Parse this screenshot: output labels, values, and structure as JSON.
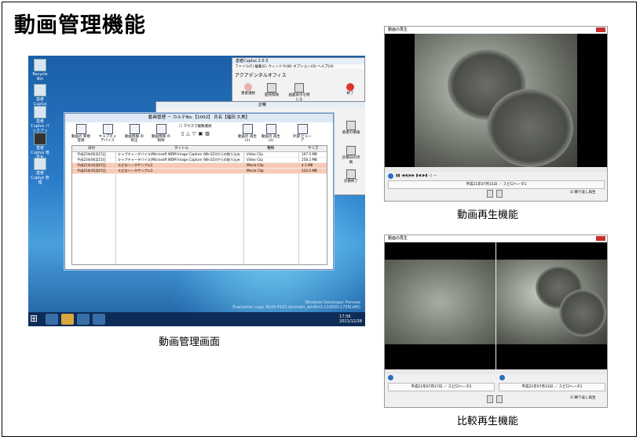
{
  "page_title": "動画管理機能",
  "captions": {
    "management": "動画管理画面",
    "playback": "動画再生機能",
    "compare": "比較再生機能"
  },
  "desktop": {
    "icons": [
      "Recycle Bin",
      "患者Cuplus",
      "患者Cuplus\nバックアップ",
      "患者Cuplus\n暗号化",
      "患者Cuplus\n管理"
    ],
    "watermark_line1": "Windows Developer Preview",
    "watermark_line2": "Evaluation copy. Build 8102.winmain_win8m3.110830-1739(x86)",
    "tray_time": "17:56",
    "tray_date": "2011/12/28"
  },
  "bg_app": {
    "title": "患者Cuplus 2.0.3",
    "menu": "ファイル(F)  編集(E)  ウィンドウ(W)  オプション(O)  ヘルプ(H)",
    "office": "アクアデンタルオフィス",
    "buttons": [
      "患者選択",
      "医院情報",
      "画面表示を閉じる",
      "終了"
    ]
  },
  "bg_exam": {
    "title": "診察",
    "side_buttons": [
      "患者の情報",
      "診察日の印刷",
      "診察終了"
    ]
  },
  "main_window": {
    "title": "動画管理 － カルテNo.【1002】 氏名【福田 久美】",
    "tools": [
      "動画の\n新規登録",
      "キャプチャ\nデバイス",
      "動画情報\nの修正",
      "動画情報\nの削除",
      "動画の\n再生(1)",
      "動画の\n再生(2)",
      "外部\nビューア"
    ],
    "checkbox": "マウスで複数選択",
    "columns": [
      "日付",
      "タイトル",
      "種類",
      "サイズ"
    ],
    "rows": [
      {
        "date": "平成23年06月15日",
        "title": "キャプチャーデバイス(Microsoft WDM Image Capture (Win32))からの取り込み",
        "type": "Video Clip",
        "size": "107.5 MB",
        "selected": false
      },
      {
        "date": "平成23年06月15日",
        "title": "キャプチャーデバイス(Microsoft WDM Image Capture (Win32))からの取り込み",
        "type": "Video Clip",
        "size": "258.2 MB",
        "selected": false
      },
      {
        "date": "平成21年10月07日",
        "title": "スピロヘータサンプル2",
        "type": "Movie Clip",
        "size": "4.1 MB",
        "selected": true
      },
      {
        "date": "平成21年10月07日",
        "title": "スピロヘータサンプル1",
        "type": "Movie Clip",
        "size": "124.2 MB",
        "selected": true
      }
    ]
  },
  "player1": {
    "title": "動画の再生",
    "info": "平成21年07月31日 ／ スピロヘータ1",
    "check": "繰り返し再生"
  },
  "player2": {
    "title": "動画の再生",
    "info_left": "平成21年07月17日 ／ スピロヘータ2",
    "info_right": "平成21年07月31日 ／ スピロヘータ1",
    "check": "繰り返し再生"
  }
}
